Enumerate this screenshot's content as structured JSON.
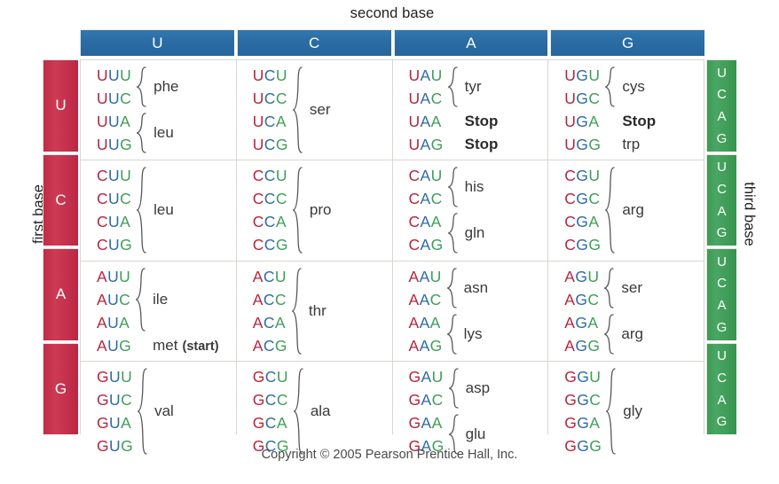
{
  "captions": {
    "second_base": "second base",
    "first_base": "first base",
    "third_base": "third base"
  },
  "colors": {
    "header_blue": "#2a6ca4",
    "first_base_red": "#c32f4b",
    "third_base_green": "#3f9d58",
    "base1_text": "#b5253f",
    "base2_text": "#2e6ca4",
    "base3_text": "#3e9e56",
    "grid_line": "#d8d6cf",
    "cell_background": "#ffffff"
  },
  "second_base_headers": [
    "U",
    "C",
    "A",
    "G"
  ],
  "first_base_labels": [
    "U",
    "C",
    "A",
    "G"
  ],
  "third_base_letters": [
    "U",
    "C",
    "A",
    "G"
  ],
  "third_base_groups": [
    [
      "U",
      "C",
      "A",
      "G"
    ],
    [
      "U",
      "C",
      "A",
      "G"
    ],
    [
      "U",
      "C",
      "A",
      "G"
    ],
    [
      "U",
      "C",
      "A",
      "G"
    ]
  ],
  "cells": [
    {
      "row": "U",
      "col": "U",
      "codons": [
        "UUU",
        "UUC",
        "UUA",
        "UUG"
      ],
      "groups": [
        {
          "label": "phe",
          "span": 2,
          "brace": true,
          "bold": false
        },
        {
          "label": "leu",
          "span": 2,
          "brace": true,
          "bold": false
        }
      ]
    },
    {
      "row": "U",
      "col": "C",
      "codons": [
        "UCU",
        "UCC",
        "UCA",
        "UCG"
      ],
      "groups": [
        {
          "label": "ser",
          "span": 4,
          "brace": true,
          "bold": false
        }
      ]
    },
    {
      "row": "U",
      "col": "A",
      "codons": [
        "UAU",
        "UAC",
        "UAA",
        "UAG"
      ],
      "groups": [
        {
          "label": "tyr",
          "span": 2,
          "brace": true,
          "bold": false
        },
        {
          "label": "Stop",
          "span": 1,
          "brace": false,
          "bold": true
        },
        {
          "label": "Stop",
          "span": 1,
          "brace": false,
          "bold": true
        }
      ]
    },
    {
      "row": "U",
      "col": "G",
      "codons": [
        "UGU",
        "UGC",
        "UGA",
        "UGG"
      ],
      "groups": [
        {
          "label": "cys",
          "span": 2,
          "brace": true,
          "bold": false
        },
        {
          "label": "Stop",
          "span": 1,
          "brace": false,
          "bold": true
        },
        {
          "label": "trp",
          "span": 1,
          "brace": false,
          "bold": false
        }
      ]
    },
    {
      "row": "C",
      "col": "U",
      "codons": [
        "CUU",
        "CUC",
        "CUA",
        "CUG"
      ],
      "groups": [
        {
          "label": "leu",
          "span": 4,
          "brace": true,
          "bold": false
        }
      ]
    },
    {
      "row": "C",
      "col": "C",
      "codons": [
        "CCU",
        "CCC",
        "CCA",
        "CCG"
      ],
      "groups": [
        {
          "label": "pro",
          "span": 4,
          "brace": true,
          "bold": false
        }
      ]
    },
    {
      "row": "C",
      "col": "A",
      "codons": [
        "CAU",
        "CAC",
        "CAA",
        "CAG"
      ],
      "groups": [
        {
          "label": "his",
          "span": 2,
          "brace": true,
          "bold": false
        },
        {
          "label": "gln",
          "span": 2,
          "brace": true,
          "bold": false
        }
      ]
    },
    {
      "row": "C",
      "col": "G",
      "codons": [
        "CGU",
        "CGC",
        "CGA",
        "CGG"
      ],
      "groups": [
        {
          "label": "arg",
          "span": 4,
          "brace": true,
          "bold": false
        }
      ]
    },
    {
      "row": "A",
      "col": "U",
      "codons": [
        "AUU",
        "AUC",
        "AUA",
        "AUG"
      ],
      "groups": [
        {
          "label": "ile",
          "span": 3,
          "brace": true,
          "bold": false
        },
        {
          "label": "met",
          "span": 1,
          "brace": false,
          "bold": false,
          "suffix": "(start)"
        }
      ]
    },
    {
      "row": "A",
      "col": "C",
      "codons": [
        "ACU",
        "ACC",
        "ACA",
        "ACG"
      ],
      "groups": [
        {
          "label": "thr",
          "span": 4,
          "brace": true,
          "bold": false
        }
      ]
    },
    {
      "row": "A",
      "col": "A",
      "codons": [
        "AAU",
        "AAC",
        "AAA",
        "AAG"
      ],
      "groups": [
        {
          "label": "asn",
          "span": 2,
          "brace": true,
          "bold": false
        },
        {
          "label": "lys",
          "span": 2,
          "brace": true,
          "bold": false
        }
      ]
    },
    {
      "row": "A",
      "col": "G",
      "codons": [
        "AGU",
        "AGC",
        "AGA",
        "AGG"
      ],
      "groups": [
        {
          "label": "ser",
          "span": 2,
          "brace": true,
          "bold": false
        },
        {
          "label": "arg",
          "span": 2,
          "brace": true,
          "bold": false
        }
      ]
    },
    {
      "row": "G",
      "col": "U",
      "codons": [
        "GUU",
        "GUC",
        "GUA",
        "GUG"
      ],
      "groups": [
        {
          "label": "val",
          "span": 4,
          "brace": true,
          "bold": false
        }
      ]
    },
    {
      "row": "G",
      "col": "C",
      "codons": [
        "GCU",
        "GCC",
        "GCA",
        "GCG"
      ],
      "groups": [
        {
          "label": "ala",
          "span": 4,
          "brace": true,
          "bold": false
        }
      ]
    },
    {
      "row": "G",
      "col": "A",
      "codons": [
        "GAU",
        "GAC",
        "GAA",
        "GAG"
      ],
      "groups": [
        {
          "label": "asp",
          "span": 2,
          "brace": true,
          "bold": false
        },
        {
          "label": "glu",
          "span": 2,
          "brace": true,
          "bold": false
        }
      ]
    },
    {
      "row": "G",
      "col": "G",
      "codons": [
        "GGU",
        "GGC",
        "GGA",
        "GGG"
      ],
      "groups": [
        {
          "label": "gly",
          "span": 4,
          "brace": true,
          "bold": false
        }
      ]
    }
  ],
  "footer": {
    "copyright": "Copyright © 2005 Pearson Prentice Hall, Inc."
  }
}
